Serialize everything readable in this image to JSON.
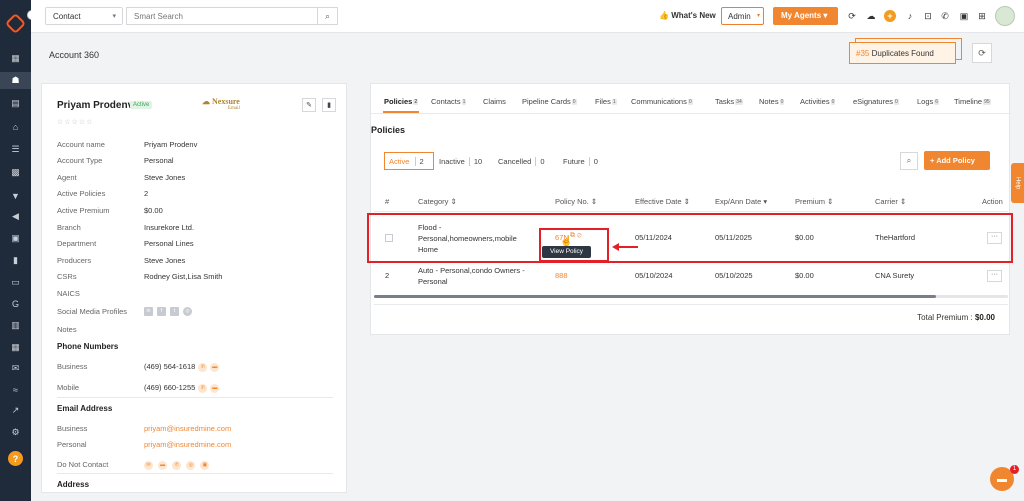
{
  "header": {
    "search_type": "Contact",
    "search_placeholder": "Smart Search",
    "whats_new": "What's New",
    "role": "Admin",
    "my_agents": "My Agents"
  },
  "page": {
    "title": "Account 360",
    "duplicates_count": "#35",
    "duplicates_label": "Duplicates Found"
  },
  "profile": {
    "name": "Priyam Prodenv",
    "status": "Active",
    "logo_text": "Nexsure",
    "logo_sub": "Email",
    "fields": [
      {
        "label": "Account name",
        "value": "Priyam Prodenv"
      },
      {
        "label": "Account Type",
        "value": "Personal"
      },
      {
        "label": "Agent",
        "value": "Steve Jones"
      },
      {
        "label": "Active Policies",
        "value": "2"
      },
      {
        "label": "Active Premium",
        "value": "$0.00"
      },
      {
        "label": "Branch",
        "value": "Insurekore Ltd."
      },
      {
        "label": "Department",
        "value": "Personal Lines"
      },
      {
        "label": "Producers",
        "value": "Steve Jones"
      },
      {
        "label": "CSRs",
        "value": "Rodney Gist,Lisa Smith"
      },
      {
        "label": "NAICS",
        "value": ""
      },
      {
        "label": "Social Media Profiles",
        "value": ""
      },
      {
        "label": "Notes",
        "value": ""
      }
    ],
    "phone_section": "Phone Numbers",
    "phones": [
      {
        "label": "Business",
        "value": "(469) 564-1618"
      },
      {
        "label": "Mobile",
        "value": "(469) 660-1255"
      }
    ],
    "email_section": "Email Address",
    "emails": [
      {
        "label": "Business",
        "value": "priyam@insuredmine.com"
      },
      {
        "label": "Personal",
        "value": "priyam@insuredmine.com"
      }
    ],
    "do_not_contact": "Do Not Contact",
    "address_section": "Address"
  },
  "tabs": [
    {
      "label": "Policies",
      "badge": "2"
    },
    {
      "label": "Contacts",
      "badge": "1"
    },
    {
      "label": "Claims",
      "badge": ""
    },
    {
      "label": "Pipeline Cards",
      "badge": "0"
    },
    {
      "label": "Files",
      "badge": "1"
    },
    {
      "label": "Communications",
      "badge": "0"
    },
    {
      "label": "Tasks",
      "badge": "34"
    },
    {
      "label": "Notes",
      "badge": "0"
    },
    {
      "label": "Activities",
      "badge": "0"
    },
    {
      "label": "eSignatures",
      "badge": "0"
    },
    {
      "label": "Logs",
      "badge": "6"
    },
    {
      "label": "Timeline",
      "badge": "95"
    }
  ],
  "policies": {
    "title": "Policies",
    "filters": [
      {
        "label": "Active",
        "count": "2"
      },
      {
        "label": "Inactive",
        "count": "10"
      },
      {
        "label": "Cancelled",
        "count": "0"
      },
      {
        "label": "Future",
        "count": "0"
      }
    ],
    "add_button": "Add Policy",
    "columns": [
      "#",
      "Category",
      "Policy No.",
      "Effective Date",
      "Exp/Ann Date",
      "Premium",
      "Carrier",
      "Action"
    ],
    "rows": [
      {
        "num": "",
        "category": "Flood - Personal,homeowners,mobile Home",
        "policy_no": "67N",
        "effective": "05/11/2024",
        "expiry": "05/11/2025",
        "premium": "$0.00",
        "carrier": "TheHartford"
      },
      {
        "num": "2",
        "category": "Auto - Personal,condo Owners - Personal",
        "policy_no": "888",
        "effective": "05/10/2024",
        "expiry": "05/10/2025",
        "premium": "$0.00",
        "carrier": "CNA Surety"
      }
    ],
    "tooltip": "View Policy",
    "total_label": "Total Premium :",
    "total_value": "$0.00"
  },
  "help": "Help",
  "chat_badge": "1",
  "colors": {
    "accent": "#f18630",
    "sidebar": "#1f2a3a",
    "highlight": "#e32026"
  }
}
